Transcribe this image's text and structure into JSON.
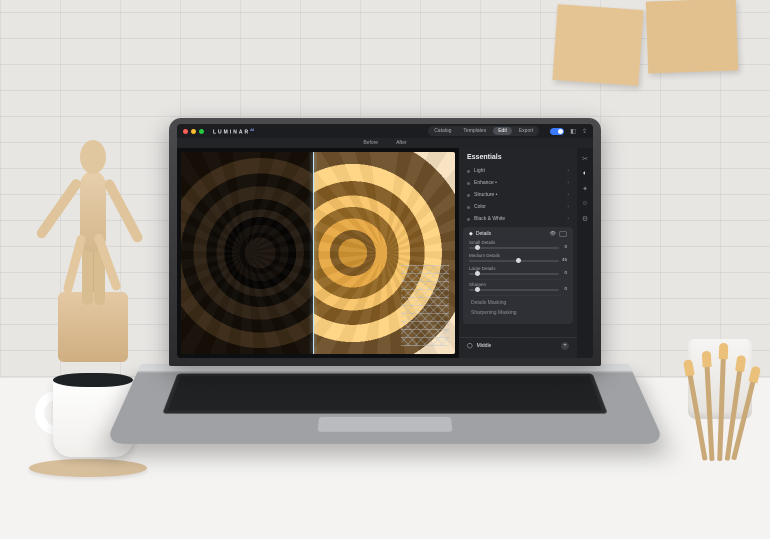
{
  "app": {
    "brand": "LUMINAR",
    "brand_suffix": "AI",
    "modes": [
      "Catalog",
      "Templates",
      "Edit",
      "Export"
    ],
    "active_mode": "Edit",
    "compare": {
      "before": "Before",
      "after": "After"
    }
  },
  "panel": {
    "title": "Essentials",
    "tools": [
      {
        "label": "Light",
        "mod": false
      },
      {
        "label": "Enhance",
        "mod": true
      },
      {
        "label": "Structure",
        "mod": true
      },
      {
        "label": "Color",
        "mod": false
      },
      {
        "label": "Black & White",
        "mod": false
      }
    ],
    "open_tool": {
      "label": "Details",
      "sliders": [
        {
          "label": "Small Details",
          "value": 0,
          "pos": 6
        },
        {
          "label": "Medium Details",
          "value": 45,
          "pos": 48
        },
        {
          "label": "Large Details",
          "value": 0,
          "pos": 6
        },
        {
          "label": "Sharpen",
          "value": 0,
          "pos": 6
        }
      ],
      "subs": [
        "Details Masking",
        "Sharpening Masking"
      ]
    },
    "bottom": {
      "label": "Middle"
    }
  },
  "iconstrip": {
    "items": [
      "crop-icon",
      "essentials-icon",
      "creative-icon",
      "portrait-icon",
      "pro-icon"
    ]
  }
}
